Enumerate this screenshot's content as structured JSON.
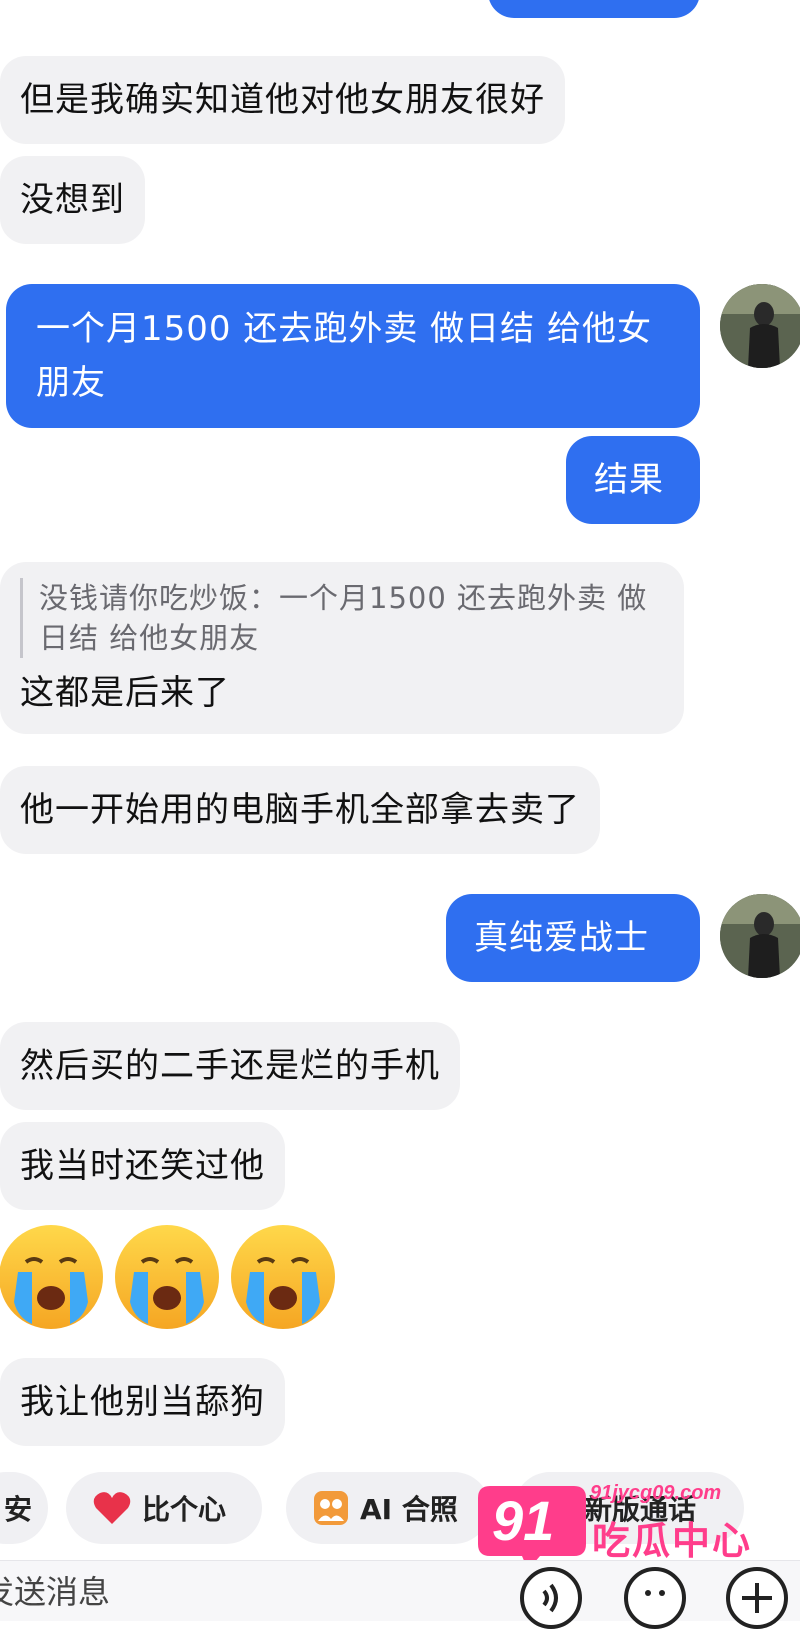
{
  "messages": [
    {
      "text": "但是我确实知道他对他女朋友很好"
    },
    {
      "text": "没想到"
    },
    {
      "text": "一个月1500 还去跑外卖 做日结 给他女朋友"
    },
    {
      "text": "结果"
    },
    {
      "quote": "没钱请你吃炒饭：一个月1500 还去跑外卖 做日结 给他女朋友",
      "text": "这都是后来了"
    },
    {
      "text": "他一开始用的电脑手机全部拿去卖了"
    },
    {
      "text": "真纯爱战士"
    },
    {
      "text": "然后买的二手还是烂的手机"
    },
    {
      "text": "我当时还笑过他"
    },
    {
      "text": "我让他别当舔狗"
    }
  ],
  "quick_actions": {
    "partial_left": "安",
    "heart": "比个心",
    "ai_photo": "AI 合照",
    "partial_third": "新版通话"
  },
  "input": {
    "placeholder": "发送消息"
  },
  "watermark": {
    "number": "91",
    "domain": "91jycg09.com",
    "name": "吃瓜中心"
  },
  "colors": {
    "outgoing": "#2f6ff0",
    "incoming": "#f1f1f3",
    "watermark": "#ff3d8b"
  }
}
